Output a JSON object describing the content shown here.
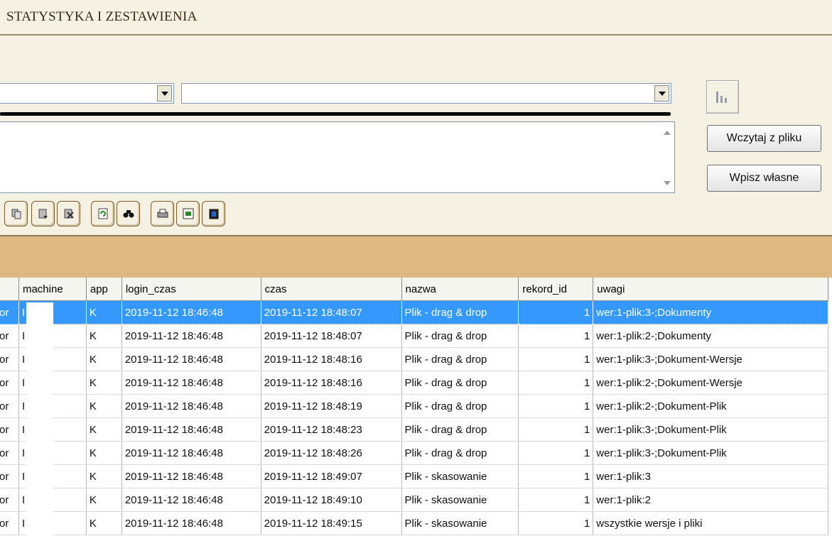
{
  "title": "STATYSTYKA I ZESTAWIENIA",
  "combo1": {
    "value": ""
  },
  "combo2": {
    "value": ""
  },
  "buttons": {
    "load_file": "Wczytaj z pliku",
    "enter_own": "Wpisz własne"
  },
  "toolbar_icons": [
    "copy-icon",
    "move-icon",
    "delete-icon",
    "refresh-icon",
    "find-icon",
    "print-icon",
    "export-icon",
    "clipboard-icon"
  ],
  "table": {
    "columns": [
      "",
      "machine",
      "app",
      "login_czas",
      "czas",
      "nazwa",
      "rekord_id",
      "uwagi"
    ],
    "rows": [
      [
        "or",
        "I 2",
        "K",
        "2019-11-12 18:46:48",
        "2019-11-12 18:48:07",
        "Plik - drag & drop",
        "1",
        "wer:1-plik:3-;Dokumenty"
      ],
      [
        "or",
        "I 2",
        "K",
        "2019-11-12 18:46:48",
        "2019-11-12 18:48:07",
        "Plik - drag & drop",
        "1",
        "wer:1-plik:2-;Dokumenty"
      ],
      [
        "or",
        "I 2",
        "K",
        "2019-11-12 18:46:48",
        "2019-11-12 18:48:16",
        "Plik - drag & drop",
        "1",
        "wer:1-plik:3-;Dokument-Wersje"
      ],
      [
        "or",
        "I 2",
        "K",
        "2019-11-12 18:46:48",
        "2019-11-12 18:48:16",
        "Plik - drag & drop",
        "1",
        "wer:1-plik:2-;Dokument-Wersje"
      ],
      [
        "or",
        "I 2",
        "K",
        "2019-11-12 18:46:48",
        "2019-11-12 18:48:19",
        "Plik - drag & drop",
        "1",
        "wer:1-plik:2-;Dokument-Plik"
      ],
      [
        "or",
        "I 2",
        "K",
        "2019-11-12 18:46:48",
        "2019-11-12 18:48:23",
        "Plik - drag & drop",
        "1",
        "wer:1-plik:3-;Dokument-Plik"
      ],
      [
        "or",
        "I 2",
        "K",
        "2019-11-12 18:46:48",
        "2019-11-12 18:48:26",
        "Plik - drag & drop",
        "1",
        "wer:1-plik:3-;Dokument-Plik"
      ],
      [
        "or",
        "I 2",
        "K",
        "2019-11-12 18:46:48",
        "2019-11-12 18:49:07",
        "Plik - skasowanie",
        "1",
        "wer:1-plik:3"
      ],
      [
        "or",
        "I 2",
        "K",
        "2019-11-12 18:46:48",
        "2019-11-12 18:49:10",
        "Plik - skasowanie",
        "1",
        "wer:1-plik:2"
      ],
      [
        "or",
        "I 2",
        "K",
        "2019-11-12 18:46:48",
        "2019-11-12 18:49:15",
        "Plik - skasowanie",
        "1",
        "wszystkie wersje i pliki"
      ]
    ],
    "selected_row": 0
  },
  "colors": {
    "background": "#f4f0e2",
    "band": "#ddb981",
    "selection": "#3399ff"
  }
}
